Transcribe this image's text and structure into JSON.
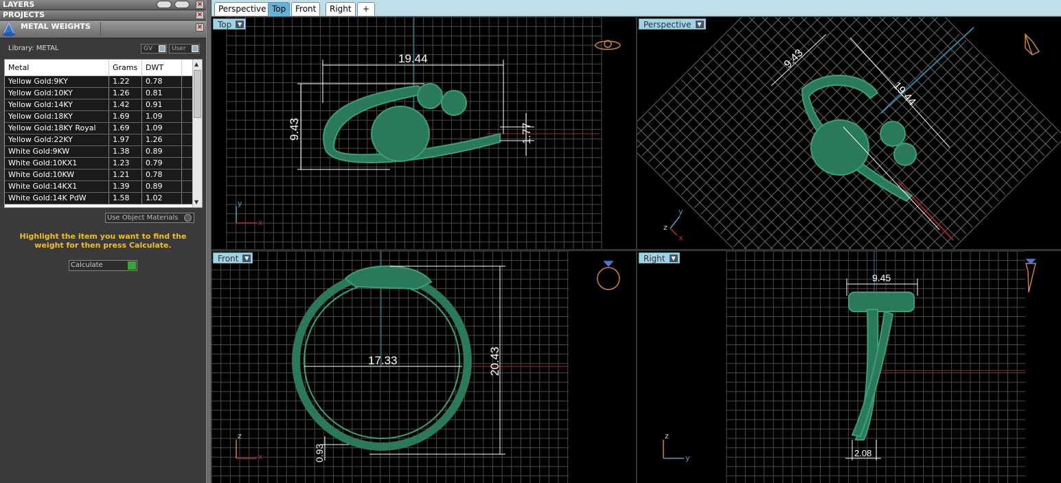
{
  "panels": {
    "layers": "LAYERS",
    "projects": "PROJECTS",
    "metal_weights": "METAL WEIGHTS"
  },
  "library": {
    "label": "Library: METAL",
    "gv_label": "GV",
    "user_label": "User"
  },
  "table": {
    "headers": [
      "Metal",
      "Grams",
      "DWT"
    ],
    "rows": [
      [
        "Yellow Gold:9KY",
        "1.22",
        "0.78"
      ],
      [
        "Yellow Gold:10KY",
        "1.26",
        "0.81"
      ],
      [
        "Yellow Gold:14KY",
        "1.42",
        "0.91"
      ],
      [
        "Yellow Gold:18KY",
        "1.69",
        "1.09"
      ],
      [
        "Yellow Gold:18KY Royal",
        "1.69",
        "1.09"
      ],
      [
        "Yellow Gold:22KY",
        "1.97",
        "1.26"
      ],
      [
        "White Gold:9KW",
        "1.38",
        "0.89"
      ],
      [
        "White Gold:10KX1",
        "1.23",
        "0.79"
      ],
      [
        "White Gold:10KW",
        "1.21",
        "0.78"
      ],
      [
        "White Gold:14KX1",
        "1.39",
        "0.89"
      ],
      [
        "White Gold:14K PdW",
        "1.58",
        "1.02"
      ]
    ]
  },
  "use_object_materials": "Use Object Materials",
  "hint": "Highlight the item you want to find the weight for then press Calculate.",
  "calculate": "Calculate",
  "tabs": [
    "Perspective",
    "Top",
    "Front",
    "Right"
  ],
  "viewports": {
    "top": {
      "label": "Top",
      "dims": [
        "19.44",
        "9.43",
        "1.77"
      ],
      "axes": [
        "y",
        "x"
      ]
    },
    "perspective": {
      "label": "Perspective",
      "dims": [
        "9.43",
        "19.44"
      ],
      "axes": [
        "y",
        "z",
        "x"
      ]
    },
    "front": {
      "label": "Front",
      "dims": [
        "17.33",
        "20.43",
        "0.93"
      ],
      "axes": [
        "z",
        "x"
      ]
    },
    "right": {
      "label": "Right",
      "dims": [
        "9.45",
        "2.08"
      ],
      "axes": [
        "z",
        "y"
      ]
    }
  },
  "colors": {
    "model": "#2a7a5a",
    "grid": "#555555",
    "accent": "#5fb4d8",
    "hint": "#f0c020"
  }
}
